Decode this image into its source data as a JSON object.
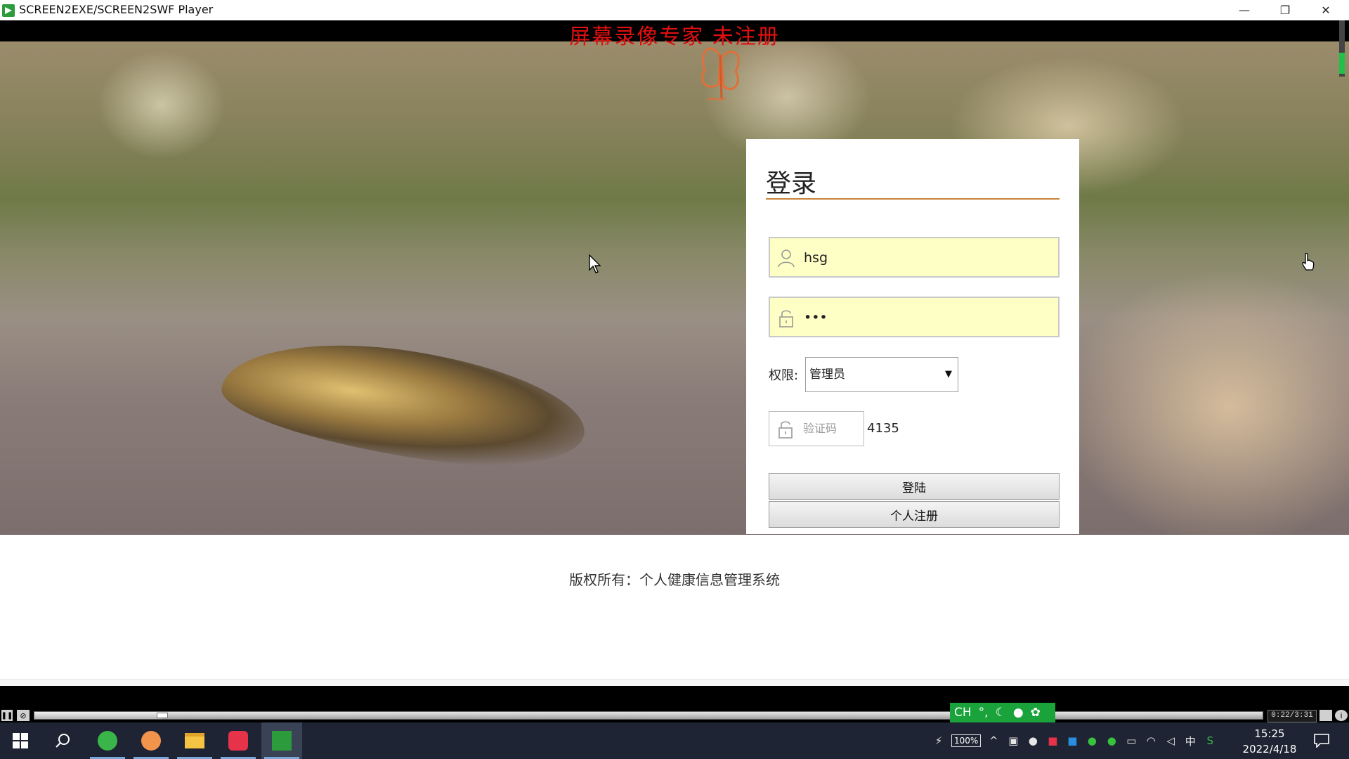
{
  "window": {
    "title": "SCREEN2EXE/SCREEN2SWF Player",
    "minimize_glyph": "—",
    "restore_glyph": "❐",
    "close_glyph": "✕"
  },
  "watermark": "屏幕录像专家 未注册",
  "login": {
    "title": "登录",
    "username_value": "hsg",
    "password_value": "•••",
    "role_label": "权限:",
    "role_selected": "管理员",
    "role_arrow": "▼",
    "captcha_placeholder": "验证码",
    "captcha_code": "4135",
    "login_button": "登陆",
    "register_button": "个人注册"
  },
  "footer": {
    "copyright": "版权所有：个人健康信息管理系统"
  },
  "player": {
    "time": "0:22/3:31",
    "progress": 0.104,
    "ime_text": "CH",
    "pause_glyph": "❚❚",
    "stop_glyph": "⊘",
    "info_glyph": "i"
  },
  "taskbar": {
    "battery_text": "100%",
    "ime_char": "中",
    "time": "15:25",
    "date": "2022/4/18"
  },
  "colors": {
    "accent_orange": "#c8833a",
    "input_bg": "#fdffc4",
    "watermark_red": "#e01010",
    "ime_green": "#1aa33b",
    "taskbar_bg": "#1e2433"
  }
}
